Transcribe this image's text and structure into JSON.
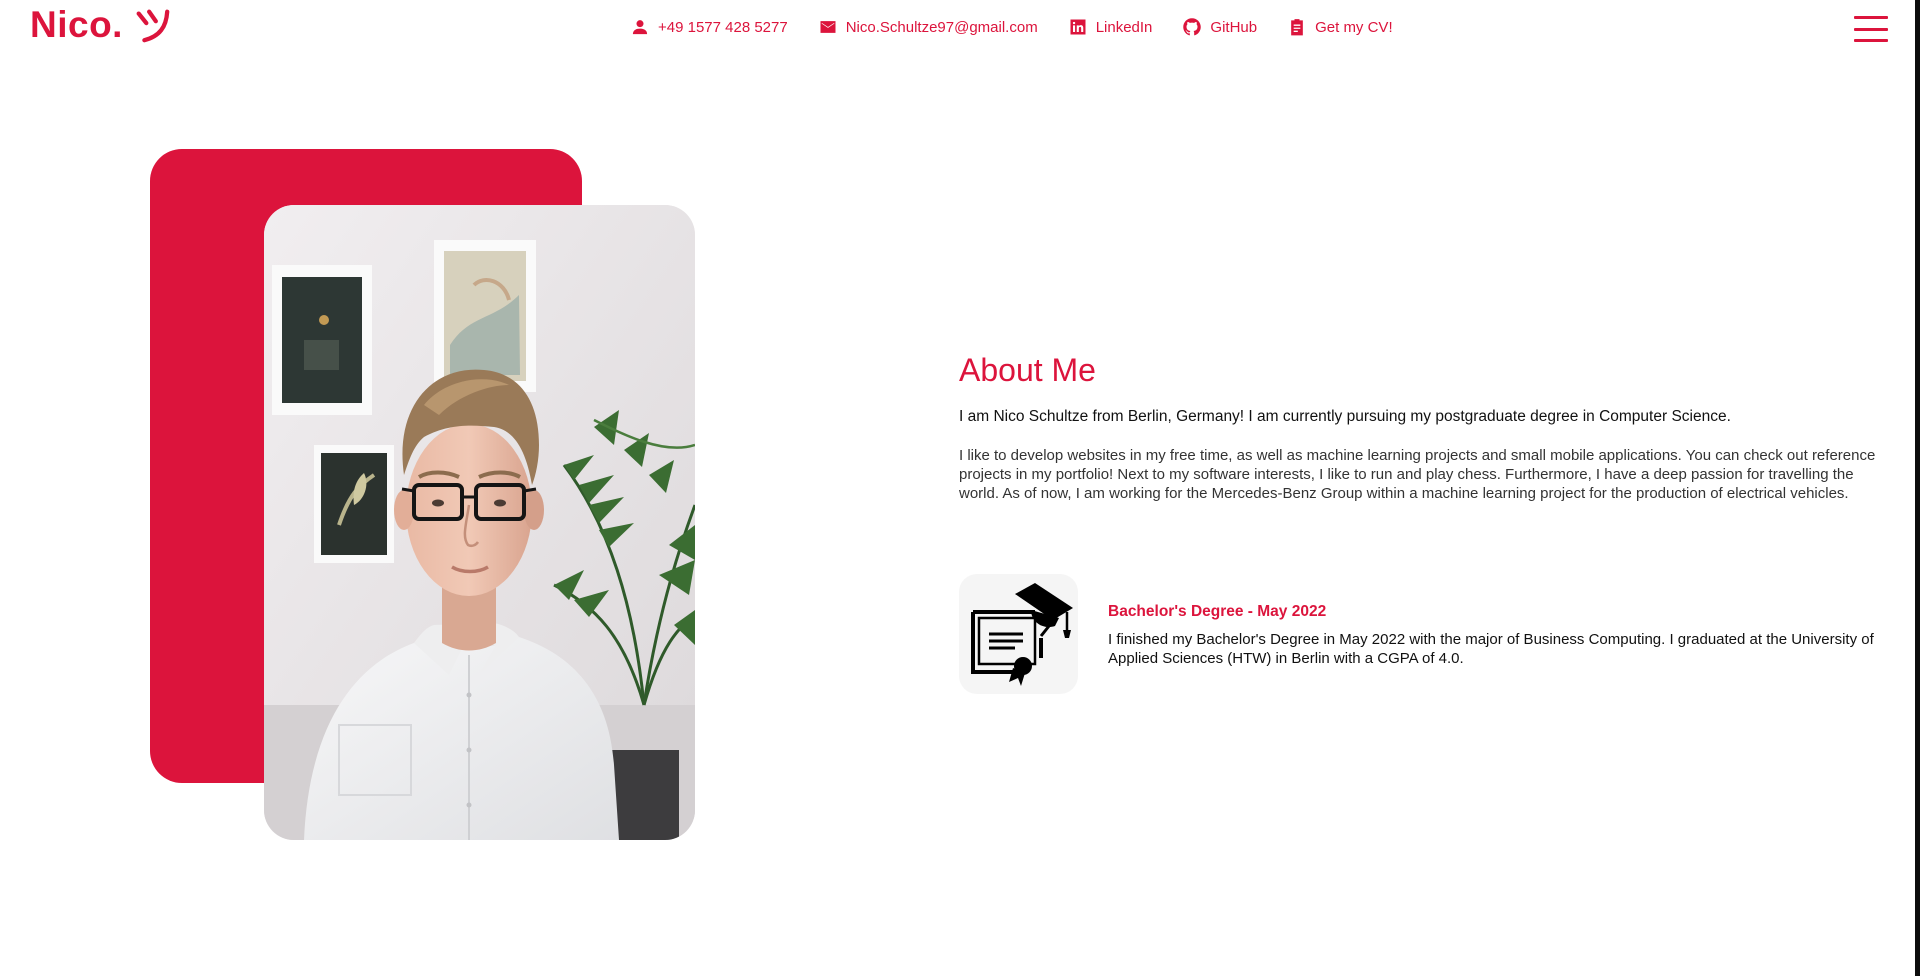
{
  "brand": {
    "logo_text": "Nico.",
    "accent_color": "#dc143c"
  },
  "nav": {
    "items": [
      {
        "icon": "person-icon",
        "label": "+49 1577 428 5277"
      },
      {
        "icon": "mail-icon",
        "label": "Nico.Schultze97@gmail.com"
      },
      {
        "icon": "linkedin-icon",
        "label": "LinkedIn"
      },
      {
        "icon": "github-icon",
        "label": "GitHub"
      },
      {
        "icon": "clipboard-icon",
        "label": "Get my CV!"
      }
    ],
    "menu_icon": "hamburger-icon"
  },
  "profile": {
    "photo": "portrait-photo"
  },
  "about": {
    "title": "About Me",
    "intro": "I am Nico Schultze from Berlin, Germany! I am currently pursuing my postgraduate degree in Computer Science.",
    "body": "I like to develop websites in my free time, as well as machine learning projects and small mobile applications. You can check out reference projects in my portfolio! Next to my software interests, I like to run and play chess. Furthermore, I have a deep passion for travelling the world. As of now, I am working for the Mercedes-Benz Group within a machine learning project for the production of electrical vehicles."
  },
  "education": {
    "icon": "diploma-icon",
    "title": "Bachelor's Degree - May 2022",
    "description": "I finished my Bachelor's Degree in May 2022 with the major of Business Computing. I graduated at the University of Applied Sciences (HTW) in Berlin with a CGPA of 4.0."
  }
}
